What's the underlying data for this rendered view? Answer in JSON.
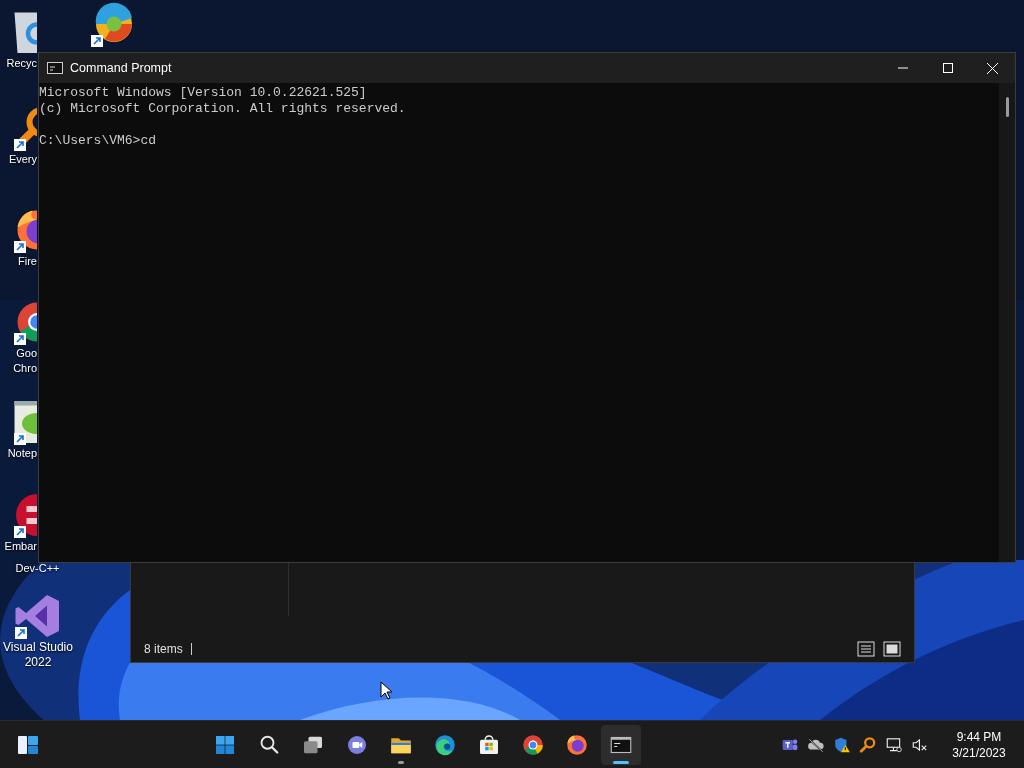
{
  "desktop_icons": [
    {
      "kind": "recycle-bin",
      "shortcut": false,
      "label_lines": [
        "Recyc"
      ]
    },
    {
      "kind": "swirl",
      "shortcut": true
    },
    {
      "kind": "magnifier",
      "shortcut": true,
      "label_lines": [
        "Every"
      ]
    },
    {
      "kind": "firefox",
      "shortcut": true,
      "label_lines": [
        "Fire"
      ]
    },
    {
      "kind": "chrome",
      "shortcut": true,
      "label_lines": [
        "Goo",
        "Chro"
      ]
    },
    {
      "kind": "notepad",
      "shortcut": true,
      "label_lines": [
        "Notep"
      ]
    },
    {
      "kind": "devcpp",
      "shortcut": true,
      "label_lines": [
        "Embar",
        "Dev-C++"
      ]
    },
    {
      "kind": "visualstudio",
      "shortcut": true,
      "label_lines": [
        "Visual Studio",
        "2022"
      ]
    }
  ],
  "explorer_window": {
    "status_text": "8 items"
  },
  "cmd_window": {
    "title": "Command Prompt",
    "header_lines": [
      "Microsoft Windows [Version 10.0.22621.525]",
      "(c) Microsoft Corporation. All rights reserved."
    ],
    "prompt_line": "C:\\Users\\VM6>cd"
  },
  "taskbar": {
    "apps": [
      {
        "kind": "windows",
        "running": false,
        "selected": false
      },
      {
        "kind": "search",
        "running": false,
        "selected": false
      },
      {
        "kind": "taskview",
        "running": false,
        "selected": false
      },
      {
        "kind": "chat",
        "running": false,
        "selected": false
      },
      {
        "kind": "folder",
        "running": true,
        "selected": false
      },
      {
        "kind": "edge",
        "running": false,
        "selected": false
      },
      {
        "kind": "store",
        "running": false,
        "selected": false
      },
      {
        "kind": "chrome",
        "running": false,
        "selected": false
      },
      {
        "kind": "firefox",
        "running": false,
        "selected": false
      },
      {
        "kind": "terminal",
        "running": true,
        "selected": true
      }
    ],
    "tray": [
      {
        "kind": "teams"
      },
      {
        "kind": "cloud-off"
      },
      {
        "kind": "shield"
      },
      {
        "kind": "magnifier"
      },
      {
        "kind": "network"
      },
      {
        "kind": "sound-off"
      }
    ],
    "time": "9:44 PM",
    "date": "3/21/2023"
  }
}
